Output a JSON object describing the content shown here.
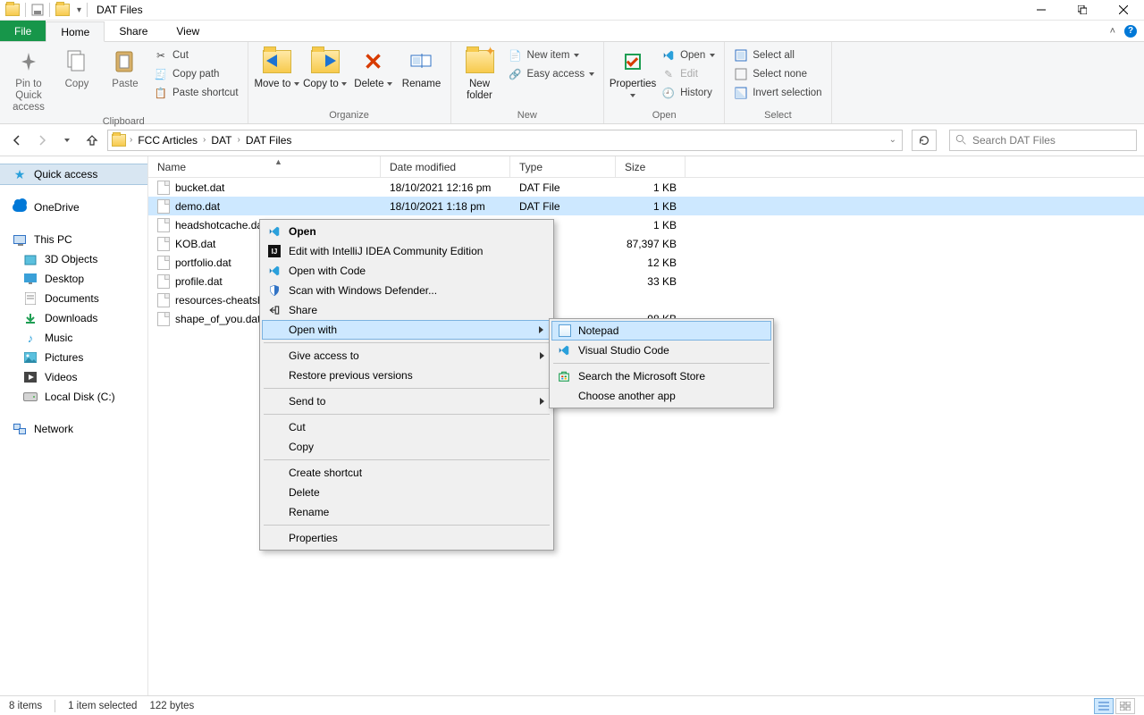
{
  "window": {
    "title": "DAT Files"
  },
  "tabs": {
    "file": "File",
    "home": "Home",
    "share": "Share",
    "view": "View"
  },
  "ribbon": {
    "clipboard": {
      "label": "Clipboard",
      "pin": "Pin to Quick access",
      "copy": "Copy",
      "paste": "Paste",
      "cut": "Cut",
      "copy_path": "Copy path",
      "paste_shortcut": "Paste shortcut"
    },
    "organize": {
      "label": "Organize",
      "move_to": "Move to",
      "copy_to": "Copy to",
      "delete": "Delete",
      "rename": "Rename"
    },
    "new": {
      "label": "New",
      "new_folder": "New folder",
      "new_item": "New item",
      "easy_access": "Easy access"
    },
    "open": {
      "label": "Open",
      "properties": "Properties",
      "open": "Open",
      "edit": "Edit",
      "history": "History"
    },
    "select": {
      "label": "Select",
      "select_all": "Select all",
      "select_none": "Select none",
      "invert": "Invert selection"
    }
  },
  "breadcrumbs": [
    "FCC Articles",
    "DAT",
    "DAT Files"
  ],
  "search": {
    "placeholder": "Search DAT Files"
  },
  "sidebar": {
    "quick_access": "Quick access",
    "onedrive": "OneDrive",
    "this_pc": "This PC",
    "items": [
      "3D Objects",
      "Desktop",
      "Documents",
      "Downloads",
      "Music",
      "Pictures",
      "Videos",
      "Local Disk (C:)"
    ],
    "network": "Network"
  },
  "columns": {
    "name": "Name",
    "date": "Date modified",
    "type": "Type",
    "size": "Size"
  },
  "files": [
    {
      "name": "bucket.dat",
      "date": "18/10/2021 12:16 pm",
      "type": "DAT File",
      "size": "1 KB"
    },
    {
      "name": "demo.dat",
      "date": "18/10/2021 1:18 pm",
      "type": "DAT File",
      "size": "1 KB",
      "selected": true
    },
    {
      "name": "headshotcache.dat",
      "date": "",
      "type": "",
      "size": "1 KB"
    },
    {
      "name": "KOB.dat",
      "date": "",
      "type": "",
      "size": "87,397 KB"
    },
    {
      "name": "portfolio.dat",
      "date": "",
      "type": "",
      "size": "12 KB"
    },
    {
      "name": "profile.dat",
      "date": "",
      "type": "",
      "size": "33 KB"
    },
    {
      "name": "resources-cheatsheet.dat",
      "date": "",
      "type": "",
      "size": ""
    },
    {
      "name": "shape_of_you.dat",
      "date": "",
      "type": "",
      "size": "98 KB"
    }
  ],
  "context_menu": {
    "open": "Open",
    "intellij": "Edit with IntelliJ IDEA Community Edition",
    "open_code": "Open with Code",
    "defender": "Scan with Windows Defender...",
    "share": "Share",
    "open_with": "Open with",
    "give_access": "Give access to",
    "restore": "Restore previous versions",
    "send_to": "Send to",
    "cut": "Cut",
    "copy": "Copy",
    "create_shortcut": "Create shortcut",
    "delete": "Delete",
    "rename": "Rename",
    "properties": "Properties"
  },
  "submenu": {
    "notepad": "Notepad",
    "vscode": "Visual Studio Code",
    "store": "Search the Microsoft Store",
    "choose": "Choose another app"
  },
  "status": {
    "count": "8 items",
    "selection": "1 item selected",
    "bytes": "122 bytes"
  }
}
